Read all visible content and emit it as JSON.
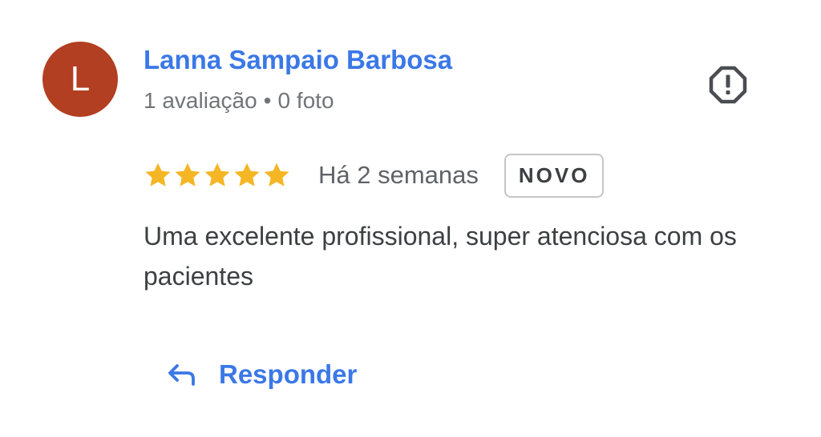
{
  "colors": {
    "avatar_bg": "#b23f22",
    "link_blue": "#3b78e7",
    "star_yellow": "#f4b625",
    "icon_dark": "#4a4d51"
  },
  "review": {
    "author": {
      "initial": "L",
      "name": "Lanna Sampaio Barbosa",
      "reviews_count": "1 avaliação",
      "separator": "•",
      "photos_count": "0 foto"
    },
    "rating": 5,
    "rating_max": 5,
    "time_ago": "Há 2 semanas",
    "badge": "NOVO",
    "text": "Uma excelente profissional, super atenciosa com os pacientes",
    "report_icon": "report-octagon-icon",
    "reply": {
      "icon": "reply-arrow-icon",
      "label": "Responder"
    }
  }
}
